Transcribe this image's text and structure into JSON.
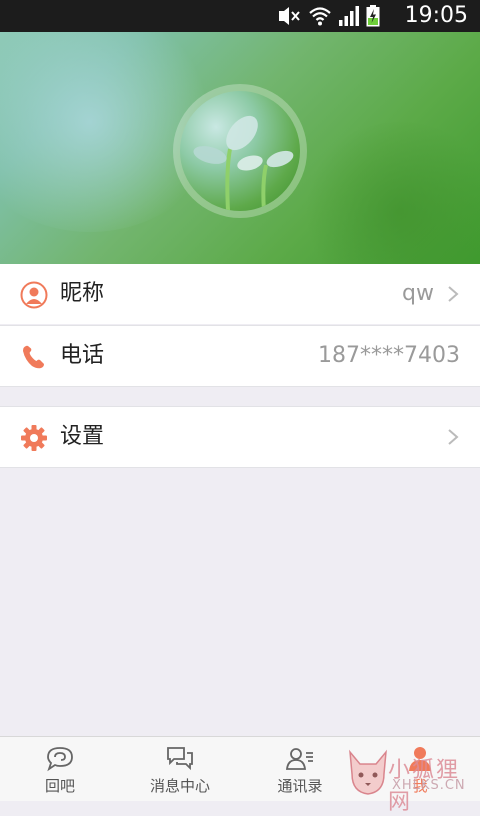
{
  "status_bar": {
    "time": "19:05",
    "icons": [
      "mute-icon",
      "wifi-icon",
      "signal-icon",
      "battery-charging-icon"
    ]
  },
  "profile": {
    "rows": [
      {
        "label": "昵称",
        "value": "qw",
        "icon": "user-icon",
        "has_arrow": true
      },
      {
        "label": "电话",
        "value": "187****7403",
        "icon": "phone-icon",
        "has_arrow": false
      }
    ],
    "settings": {
      "label": "设置",
      "icon": "gear-icon",
      "has_arrow": true
    }
  },
  "tabbar": {
    "tabs": [
      {
        "label": "回吧",
        "icon": "chat-bubble-icon",
        "active": false
      },
      {
        "label": "消息中心",
        "icon": "messages-icon",
        "active": false
      },
      {
        "label": "通讯录",
        "icon": "contacts-icon",
        "active": false
      },
      {
        "label": "我",
        "icon": "me-icon",
        "active": true
      }
    ]
  },
  "watermark": {
    "title": "小狐狸网",
    "subtitle": "XHLKS.CN"
  },
  "colors": {
    "accent": "#f07a5a",
    "background": "#efedf3",
    "text": "#222222",
    "muted": "#9a9a9a"
  }
}
